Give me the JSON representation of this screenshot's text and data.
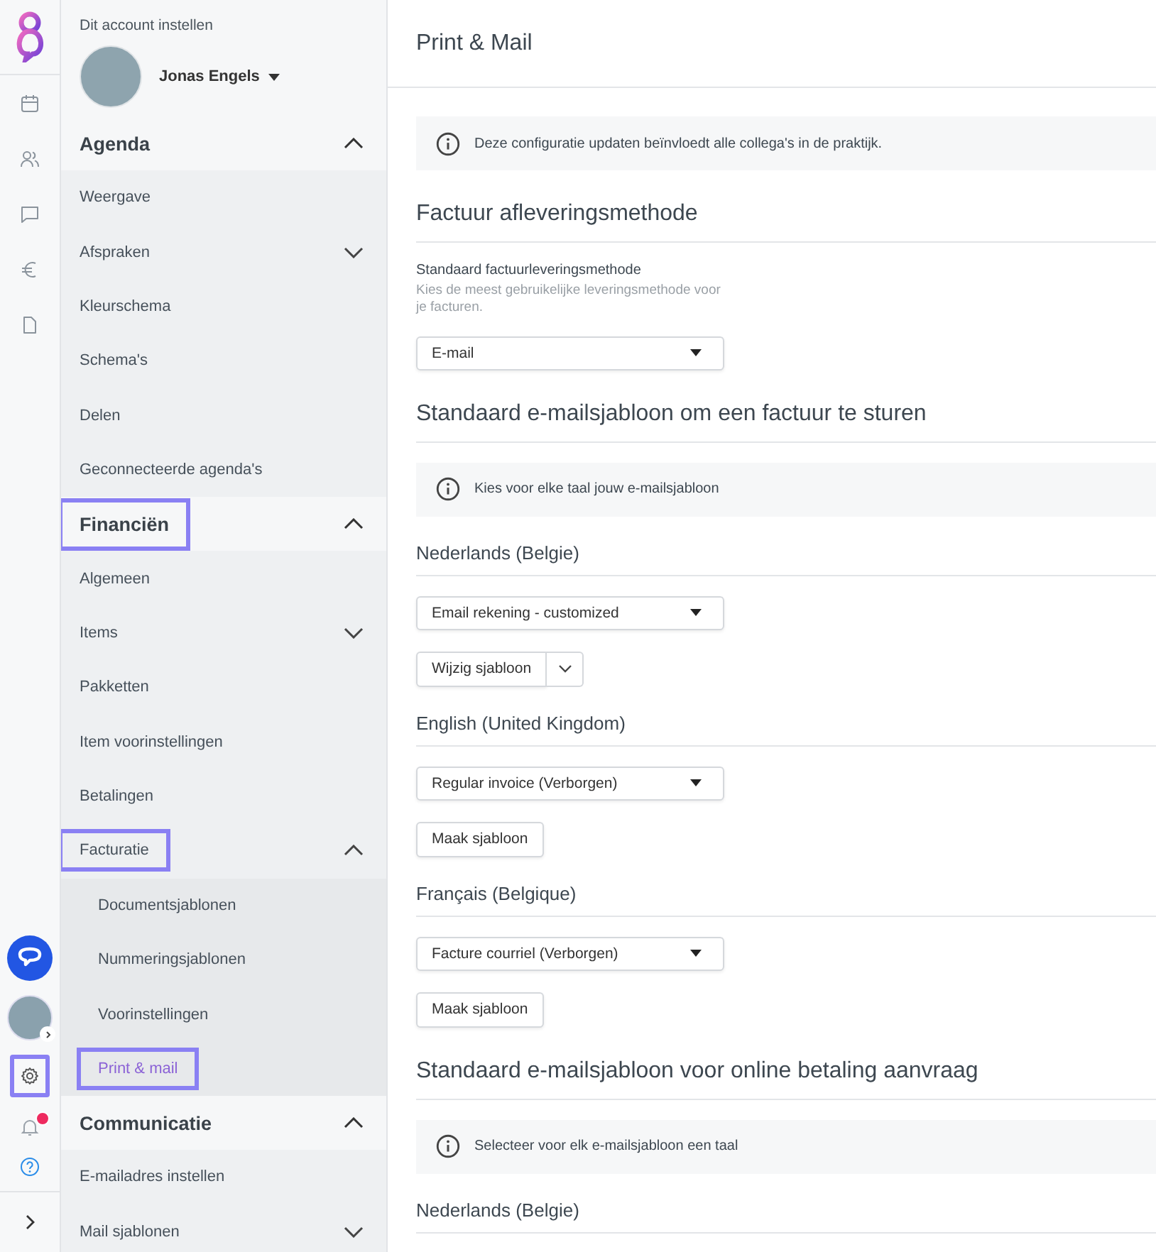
{
  "rail": {
    "settings_highlighted": true,
    "notification_badge": true
  },
  "sidebar": {
    "caption": "Dit account instellen",
    "user": {
      "name": "Jonas Engels"
    },
    "sections": [
      {
        "title": "Agenda",
        "expanded": true,
        "highlighted": false,
        "items": [
          {
            "label": "Weergave",
            "highlighted": false,
            "selected": false
          },
          {
            "label": "Afspraken",
            "expanded": false,
            "highlighted": false,
            "selected": false
          },
          {
            "label": "Kleurschema",
            "highlighted": false,
            "selected": false
          },
          {
            "label": "Schema's",
            "highlighted": false,
            "selected": false
          },
          {
            "label": "Delen",
            "highlighted": false,
            "selected": false
          },
          {
            "label": "Geconnecteerde agenda's",
            "highlighted": false,
            "selected": false
          }
        ]
      },
      {
        "title": "Financiën",
        "expanded": true,
        "highlighted": true,
        "items": [
          {
            "label": "Algemeen",
            "highlighted": false,
            "selected": false
          },
          {
            "label": "Items",
            "expanded": false,
            "highlighted": false,
            "selected": false
          },
          {
            "label": "Pakketten",
            "highlighted": false,
            "selected": false
          },
          {
            "label": "Item voorinstellingen",
            "highlighted": false,
            "selected": false
          },
          {
            "label": "Betalingen",
            "highlighted": false,
            "selected": false
          },
          {
            "label": "Facturatie",
            "expanded": true,
            "highlighted": true,
            "selected": false,
            "children": [
              {
                "label": "Documentsjablonen",
                "highlighted": false,
                "selected": false
              },
              {
                "label": "Nummeringsjablonen",
                "highlighted": false,
                "selected": false
              },
              {
                "label": "Voorinstellingen",
                "highlighted": false,
                "selected": false
              },
              {
                "label": "Print & mail",
                "highlighted": true,
                "selected": true
              }
            ]
          }
        ]
      },
      {
        "title": "Communicatie",
        "expanded": true,
        "highlighted": false,
        "items": [
          {
            "label": "E-mailadres instellen",
            "highlighted": false,
            "selected": false
          },
          {
            "label": "Mail sjablonen",
            "expanded": false,
            "highlighted": false,
            "selected": false
          }
        ]
      }
    ]
  },
  "page_title": "Print & Mail",
  "notice": "Deze configuratie updaten beïnvloedt alle collega's in de praktijk.",
  "sections": [
    {
      "kind": "field",
      "heading": "Factuur afleveringsmethode",
      "label": "Standaard factuurleveringsmethode",
      "hint": "Kies de meest gebruikelijke leveringsmethode voor je facturen.",
      "select": "E-mail"
    },
    {
      "kind": "templates",
      "heading": "Standaard e-mailsjabloon om een factuur te sturen",
      "notice": "Kies voor elke taal jouw e-mailsjabloon",
      "languages": [
        {
          "name": "Nederlands (Belgie)",
          "select": "Email rekening - customized",
          "button": {
            "label": "Wijzig sjabloon",
            "split": true
          }
        },
        {
          "name": "English (United Kingdom)",
          "select": "Regular invoice (Verborgen)",
          "button": {
            "label": "Maak sjabloon",
            "split": false
          }
        },
        {
          "name": "Français (Belgique)",
          "select": "Facture courriel (Verborgen)",
          "button": {
            "label": "Maak sjabloon",
            "split": false
          }
        }
      ]
    },
    {
      "kind": "templates",
      "heading": "Standaard e-mailsjabloon voor online betaling aanvraag",
      "notice": "Selecteer voor elk e-mailsjabloon een taal",
      "languages": [
        {
          "name": "Nederlands (Belgie)"
        }
      ]
    }
  ]
}
